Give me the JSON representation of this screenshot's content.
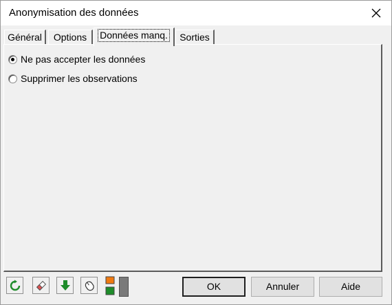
{
  "window": {
    "title": "Anonymisation des données"
  },
  "tabs": [
    {
      "label": "Général"
    },
    {
      "label": "Options"
    },
    {
      "label": "Données manq."
    },
    {
      "label": "Sorties"
    }
  ],
  "active_tab": "Données manq.",
  "missing_data": {
    "options": [
      {
        "label": "Ne pas accepter les données",
        "selected": true
      },
      {
        "label": "Supprimer les observations",
        "selected": false
      }
    ]
  },
  "toolbar": {
    "icons": [
      "reset-icon",
      "eraser-icon",
      "down-arrow-icon",
      "mouse-icon",
      "color-toggle-icon"
    ]
  },
  "buttons": {
    "ok": "OK",
    "cancel": "Annuler",
    "help": "Aide"
  },
  "colors": {
    "green_icon": "#1e8c2a",
    "orange_square": "#f07a10"
  }
}
